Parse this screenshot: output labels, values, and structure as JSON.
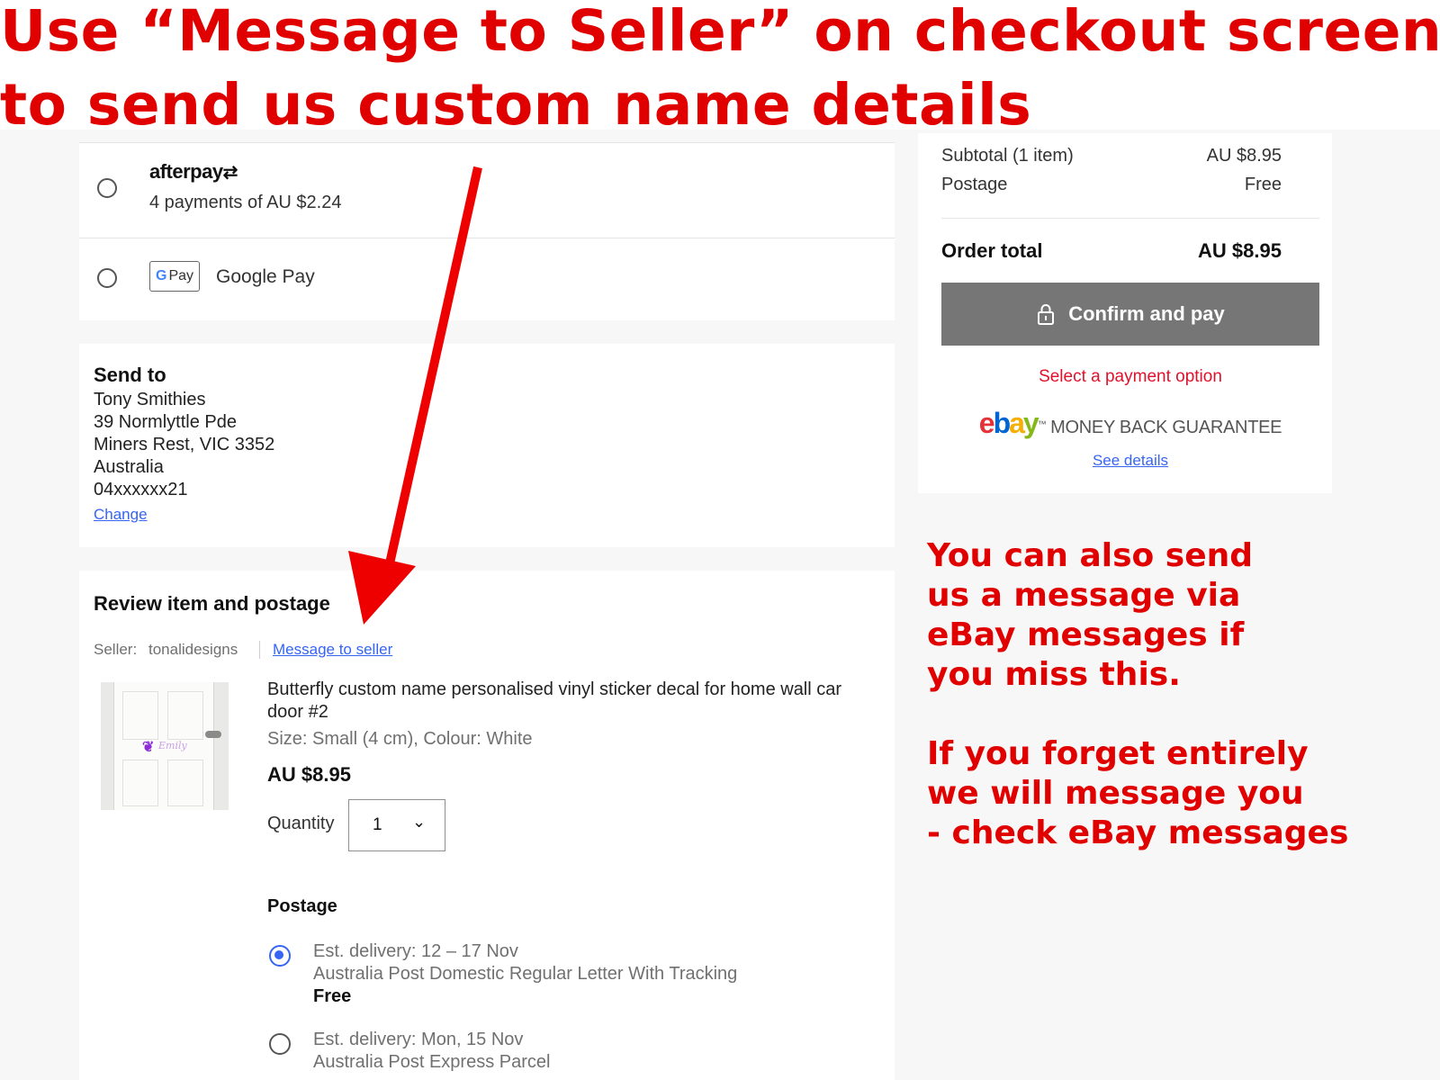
{
  "annotation": {
    "headline_line1": "Use “Message to Seller” on checkout screen",
    "headline_line2": "to send us custom name details",
    "side_note": "You can also send\nus a message via\neBay messages if\nyou miss this.\n\nIf you forget entirely\nwe will message you\n- check eBay messages",
    "color": "#e00000"
  },
  "payment": {
    "afterpay": {
      "logo": "afterpay",
      "detail": "4 payments of AU $2.24"
    },
    "google_pay": {
      "badge": "Pay",
      "label": "Google Pay"
    }
  },
  "send_to": {
    "title": "Send to",
    "lines": [
      "Tony Smithies",
      "39 Normlyttle Pde",
      "Miners Rest, VIC 3352",
      "Australia",
      "04xxxxxx21"
    ],
    "change_link": "Change"
  },
  "review": {
    "title": "Review item and postage",
    "seller_label": "Seller:",
    "seller_name": "tonalidesigns",
    "message_link": "Message to seller",
    "item": {
      "title": "Butterfly custom name personalised vinyl sticker decal for home wall car door #2",
      "variant": "Size: Small (4 cm), Colour: White",
      "price": "AU $8.95",
      "quantity_label": "Quantity",
      "quantity_value": "1",
      "sticker_text": "Emily"
    },
    "postage": {
      "title": "Postage",
      "options": [
        {
          "delivery": "Est. delivery: 12 – 17 Nov",
          "service": "Australia Post Domestic Regular Letter With Tracking",
          "price": "Free",
          "selected": true
        },
        {
          "delivery": "Est. delivery: Mon, 15 Nov",
          "service": "Australia Post Express Parcel",
          "selected": false
        }
      ]
    }
  },
  "summary": {
    "subtotal_label": "Subtotal (1 item)",
    "subtotal_value": "AU $8.95",
    "postage_label": "Postage",
    "postage_value": "Free",
    "total_label": "Order total",
    "total_value": "AU $8.95",
    "confirm_label": "Confirm and pay",
    "payment_warning": "Select a payment option",
    "guarantee_label": "MONEY BACK GUARANTEE",
    "guarantee_mark": "™",
    "see_details": "See details",
    "ebay_letters": [
      "e",
      "b",
      "a",
      "y"
    ],
    "ebay_colors": [
      "#e53238",
      "#0064d2",
      "#f5af02",
      "#86b817"
    ]
  },
  "colors": {
    "link": "#3665f3",
    "button": "#767676",
    "warning": "#e0112b"
  }
}
